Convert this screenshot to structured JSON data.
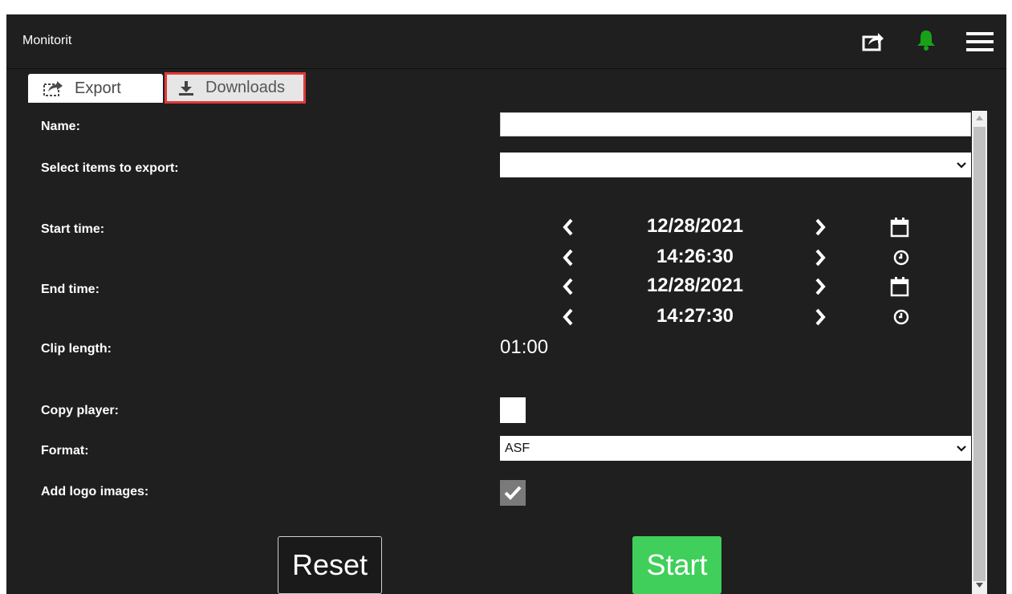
{
  "app": {
    "title": "Monitorit"
  },
  "header": {
    "icons": [
      "share-icon",
      "bell-icon",
      "hamburger-menu-icon"
    ],
    "bell_color": "#19a119"
  },
  "tabs": [
    {
      "label": "Export",
      "icon": "export-icon",
      "active": true
    },
    {
      "label": "Downloads",
      "icon": "download-icon",
      "active": false,
      "highlight": "#e23a3a"
    }
  ],
  "form": {
    "name": {
      "label": "Name:",
      "value": ""
    },
    "items": {
      "label": "Select items to export:",
      "selected": ""
    },
    "start": {
      "label": "Start time:",
      "date": "12/28/2021",
      "time": "14:26:30"
    },
    "end": {
      "label": "End time:",
      "date": "12/28/2021",
      "time": "14:27:30"
    },
    "clip": {
      "label": "Clip length:",
      "value": "01:00"
    },
    "copy_player": {
      "label": "Copy player:",
      "checked": false
    },
    "format": {
      "label": "Format:",
      "selected": "ASF"
    },
    "logo": {
      "label": "Add logo images:",
      "checked": true
    }
  },
  "buttons": {
    "reset": "Reset",
    "start": "Start",
    "start_color": "#3fcf5a"
  }
}
